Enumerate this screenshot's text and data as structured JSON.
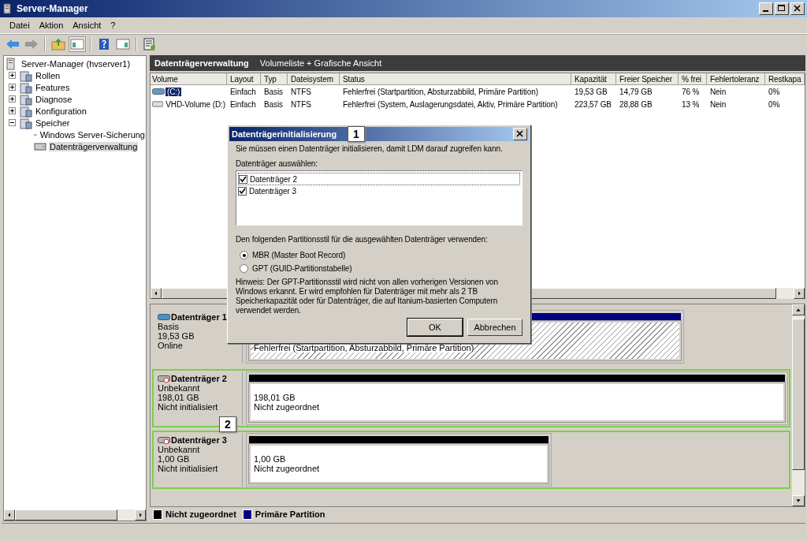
{
  "window": {
    "title": "Server-Manager"
  },
  "menu": [
    "Datei",
    "Aktion",
    "Ansicht",
    "?"
  ],
  "tree": {
    "label": "Server-Manager (hvserver1)",
    "children": [
      {
        "label": "Rollen",
        "expanded": false,
        "selected": false
      },
      {
        "label": "Features",
        "expanded": false,
        "selected": false
      },
      {
        "label": "Diagnose",
        "expanded": false,
        "selected": false
      },
      {
        "label": "Konfiguration",
        "expanded": false,
        "selected": false
      },
      {
        "label": "Speicher",
        "expanded": true,
        "selected": false,
        "children": [
          {
            "label": "Windows Server-Sicherung",
            "selected": false
          },
          {
            "label": "Datenträgerverwaltung",
            "selected": true
          }
        ]
      }
    ]
  },
  "header": {
    "title": "Datenträgerverwaltung",
    "subtitle": "Volumeliste + Grafische Ansicht"
  },
  "volumes": {
    "columns": [
      "Volume",
      "Layout",
      "Typ",
      "Dateisystem",
      "Status",
      "Kapazität",
      "Freier Speicher",
      "% frei",
      "Fehlertoleranz",
      "Restkapa"
    ],
    "rows": [
      {
        "selected": true,
        "cells": [
          "(C:)",
          "Einfach",
          "Basis",
          "NTFS",
          "Fehlerfrei (Startpartition, Absturzabbild, Primäre Partition)",
          "19,53 GB",
          "14,79 GB",
          "76 %",
          "Nein",
          "0%"
        ]
      },
      {
        "selected": false,
        "cells": [
          "VHD-Volume (D:)",
          "Einfach",
          "Basis",
          "NTFS",
          "Fehlerfrei (System, Auslagerungsdatei, Aktiv, Primäre Partition)",
          "223,57 GB",
          "28,88 GB",
          "13 %",
          "Nein",
          "0%"
        ]
      }
    ]
  },
  "disks": [
    {
      "name": "Datenträger 1",
      "kind": "basic",
      "highlighted": false,
      "info": [
        "Basis",
        "19,53 GB",
        "Online"
      ],
      "partition": {
        "kind": "primary",
        "selected": true,
        "lines": [
          "Fehlerfrei (Startpartition, Absturzabbild, Primäre Partition)"
        ]
      }
    },
    {
      "name": "Datenträger 2",
      "kind": "unknown",
      "highlighted": true,
      "info": [
        "Unbekannt",
        "198,01 GB",
        "Nicht initialisiert"
      ],
      "partition": {
        "kind": "unallocated",
        "selected": false,
        "lines": [
          "198,01 GB",
          "Nicht zugeordnet"
        ]
      }
    },
    {
      "name": "Datenträger 3",
      "kind": "unknown",
      "highlighted": true,
      "info": [
        "Unbekannt",
        "1,00 GB",
        "Nicht initialisiert"
      ],
      "partition": {
        "kind": "unallocated",
        "selected": false,
        "lines": [
          "1,00 GB",
          "Nicht zugeordnet"
        ]
      }
    }
  ],
  "legend": [
    {
      "label": "Nicht zugeordnet",
      "color": "#000000"
    },
    {
      "label": "Primäre Partition",
      "color": "#000080"
    }
  ],
  "dialog": {
    "title": "Datenträgerinitialisierung",
    "message": "Sie müssen einen Datenträger initialisieren, damit LDM darauf zugreifen kann.",
    "select_label": "Datenträger auswählen:",
    "disks": [
      {
        "label": "Datenträger 2",
        "checked": true
      },
      {
        "label": "Datenträger 3",
        "checked": true
      }
    ],
    "style_label": "Den folgenden Partitionsstil für die ausgewählten Datenträger verwenden:",
    "styles": [
      {
        "label": "MBR (Master Boot Record)",
        "selected": true
      },
      {
        "label": "GPT (GUID-Partitionstabelle)",
        "selected": false
      }
    ],
    "note": "Hinweis: Der GPT-Partitionsstil wird nicht von allen vorherigen Versionen von Windows erkannt. Er wird empfohlen für Datenträger mit mehr als 2 TB Speicherkapazität oder für Datenträger, die auf Itanium-basierten Computern verwendet werden.",
    "buttons": [
      {
        "label": "OK",
        "default": true
      },
      {
        "label": "Abbrechen",
        "default": false
      }
    ]
  },
  "callouts": [
    "1",
    "2"
  ]
}
